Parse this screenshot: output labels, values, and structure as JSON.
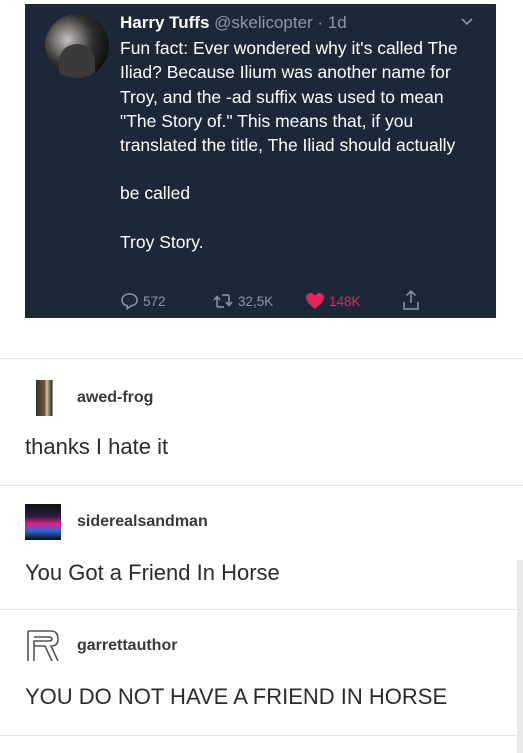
{
  "tweet": {
    "name": "Harry Tuffs",
    "handle": "@skelicopter",
    "separator": " · ",
    "time": "1d",
    "paragraphs": [
      "Fun fact: Ever wondered why it's called The Iliad? Because Ilium was another name for Troy, and the -ad suffix was used to mean \"The Story of.\" This means that, if you translated the title, The Iliad should actually",
      "be called",
      "Troy Story."
    ],
    "replies": "572",
    "retweets": "32,5K",
    "likes": "148K",
    "like_color": "#e0245e",
    "background": "#1c2838"
  },
  "posts": [
    {
      "username": "awed-frog",
      "text": "thanks I hate it",
      "avatar_icon": "frog-avatar"
    },
    {
      "username": "siderealsandman",
      "text": "You Got a Friend In Horse",
      "avatar_icon": "neon-avatar"
    },
    {
      "username": "garrettauthor",
      "text": "YOU DO NOT HAVE A FRIEND IN HORSE",
      "avatar_icon": "letter-r-avatar"
    }
  ]
}
